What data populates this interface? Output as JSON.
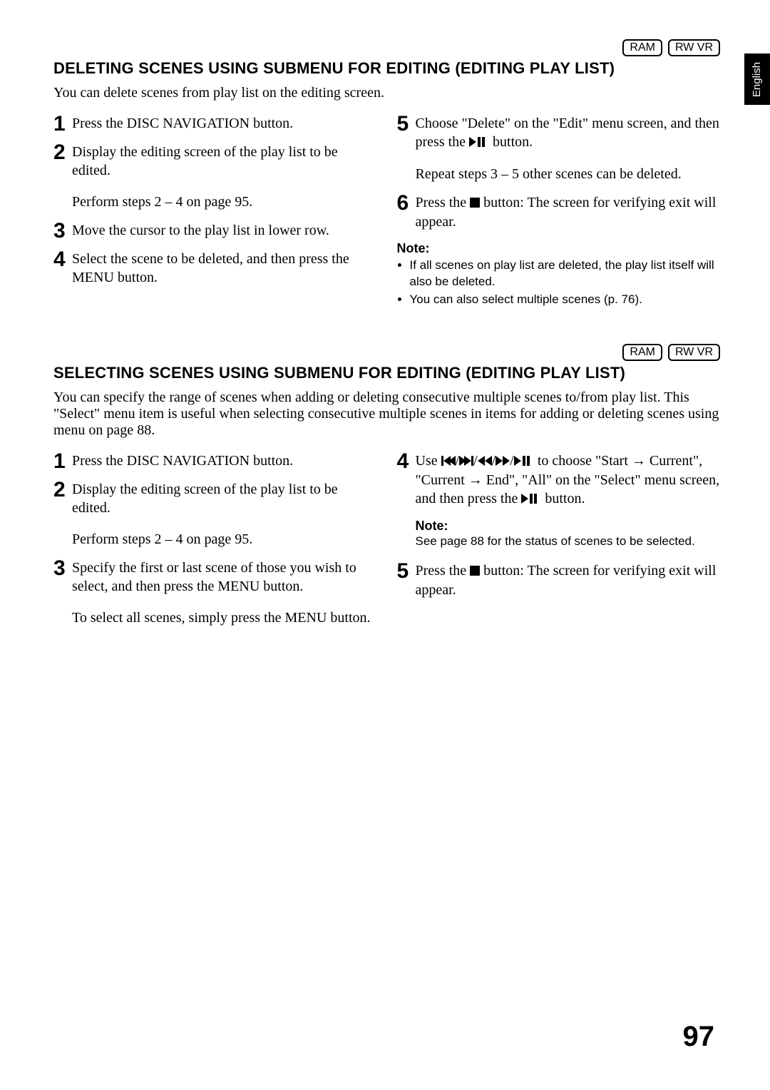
{
  "sideTab": "English",
  "badges": {
    "ram": "RAM",
    "rwvr": "RW VR"
  },
  "pageNumber": "97",
  "section1": {
    "heading": "DELETING SCENES USING SUBMENU FOR EDITING (EDITING PLAY LIST)",
    "intro": "You can delete scenes from play list on the editing screen.",
    "left": {
      "s1": "Press the DISC NAVIGATION button.",
      "s2": "Display the editing screen of the play list to be edited.",
      "s2sub": "Perform steps 2 – 4 on page 95.",
      "s3": "Move the cursor to the play list in lower row.",
      "s4": "Select the scene to be deleted, and then press the MENU button."
    },
    "right": {
      "s5a": "Choose \"Delete\" on the \"Edit\" menu screen, and then press the",
      "s5b": "button.",
      "s5sub": "Repeat steps 3 – 5 other scenes can be deleted.",
      "s6a": "Press the",
      "s6b": "button: The screen for verifying exit will appear.",
      "noteHead": "Note:",
      "note1": "If all scenes on play list are deleted, the play list itself will also be deleted.",
      "note2": "You can also select multiple scenes (p. 76)."
    }
  },
  "section2": {
    "heading": "SELECTING SCENES USING SUBMENU FOR EDITING (EDITING PLAY LIST)",
    "intro": "You can specify the range of scenes when adding or deleting consecutive multiple scenes to/from play list. This \"Select\" menu item is useful when selecting consecutive multiple scenes in items for adding or deleting scenes using menu on page 88.",
    "left": {
      "s1": "Press the DISC NAVIGATION button.",
      "s2": "Display the editing screen of the play list to be edited.",
      "s2sub": "Perform steps 2 – 4 on page 95.",
      "s3": "Specify the first or last scene of those you wish to select, and then press the MENU button.",
      "s3sub": "To select all scenes, simply press the MENU button."
    },
    "right": {
      "s4a": "Use",
      "s4b": "to choose \"Start → Current\", \"Current → End\", \"All\" on the \"Select\" menu screen, and then press the",
      "s4c": "button.",
      "noteHead": "Note:",
      "note": "See page 88 for the status of scenes to be selected.",
      "s5a": "Press the",
      "s5b": "button: The screen for verifying exit will appear."
    }
  }
}
